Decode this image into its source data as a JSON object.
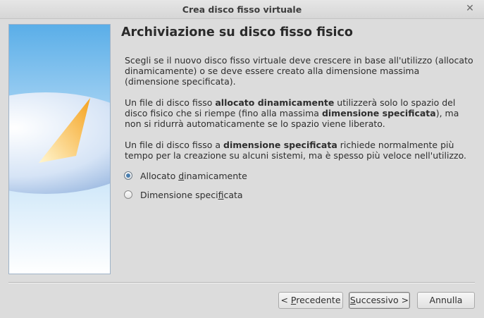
{
  "window": {
    "title": "Crea disco fisso virtuale",
    "close_glyph": "✕"
  },
  "page": {
    "heading": "Archiviazione su disco fisso fisico",
    "para1": "Scegli se il nuovo disco fisso virtuale deve crescere in base all'utilizzo (allocato dinamicamente) o se deve essere creato alla dimensione massima (dimensione specificata).",
    "para2": {
      "t1": "Un file di disco fisso ",
      "b1": "allocato dinamicamente",
      "t2": " utilizzerà solo lo spazio del disco fisico che si riempe (fino alla massima ",
      "b2": "dimensione specificata",
      "t3": "), ma non si ridurrà automaticamente se lo spazio viene liberato."
    },
    "para3": {
      "t1": "Un file di disco fisso a ",
      "b1": "dimensione specificata",
      "t2": " richiede normalmente più tempo per la creazione su alcuni sistemi, ma è spesso più veloce nell'utilizzo."
    }
  },
  "options": {
    "dynamic": {
      "pre": "Allocato ",
      "mnemonic": "d",
      "post": "inamicamente",
      "selected": true
    },
    "fixed": {
      "pre": "Dimensione speci",
      "mnemonic": "f",
      "post": "icata",
      "selected": false
    }
  },
  "buttons": {
    "back": {
      "pre": "< ",
      "mnemonic": "P",
      "post": "recedente"
    },
    "next": {
      "pre": "",
      "mnemonic": "S",
      "post": "uccessivo >"
    },
    "cancel": "Annulla"
  },
  "colors": {
    "disk_orange": "#f5a21f",
    "disk_blue": "#3a63c4",
    "radio_selected": "#4a7fb0"
  },
  "icons": {
    "side_image": "hard-disk-pie-illustration",
    "close": "close-icon"
  }
}
